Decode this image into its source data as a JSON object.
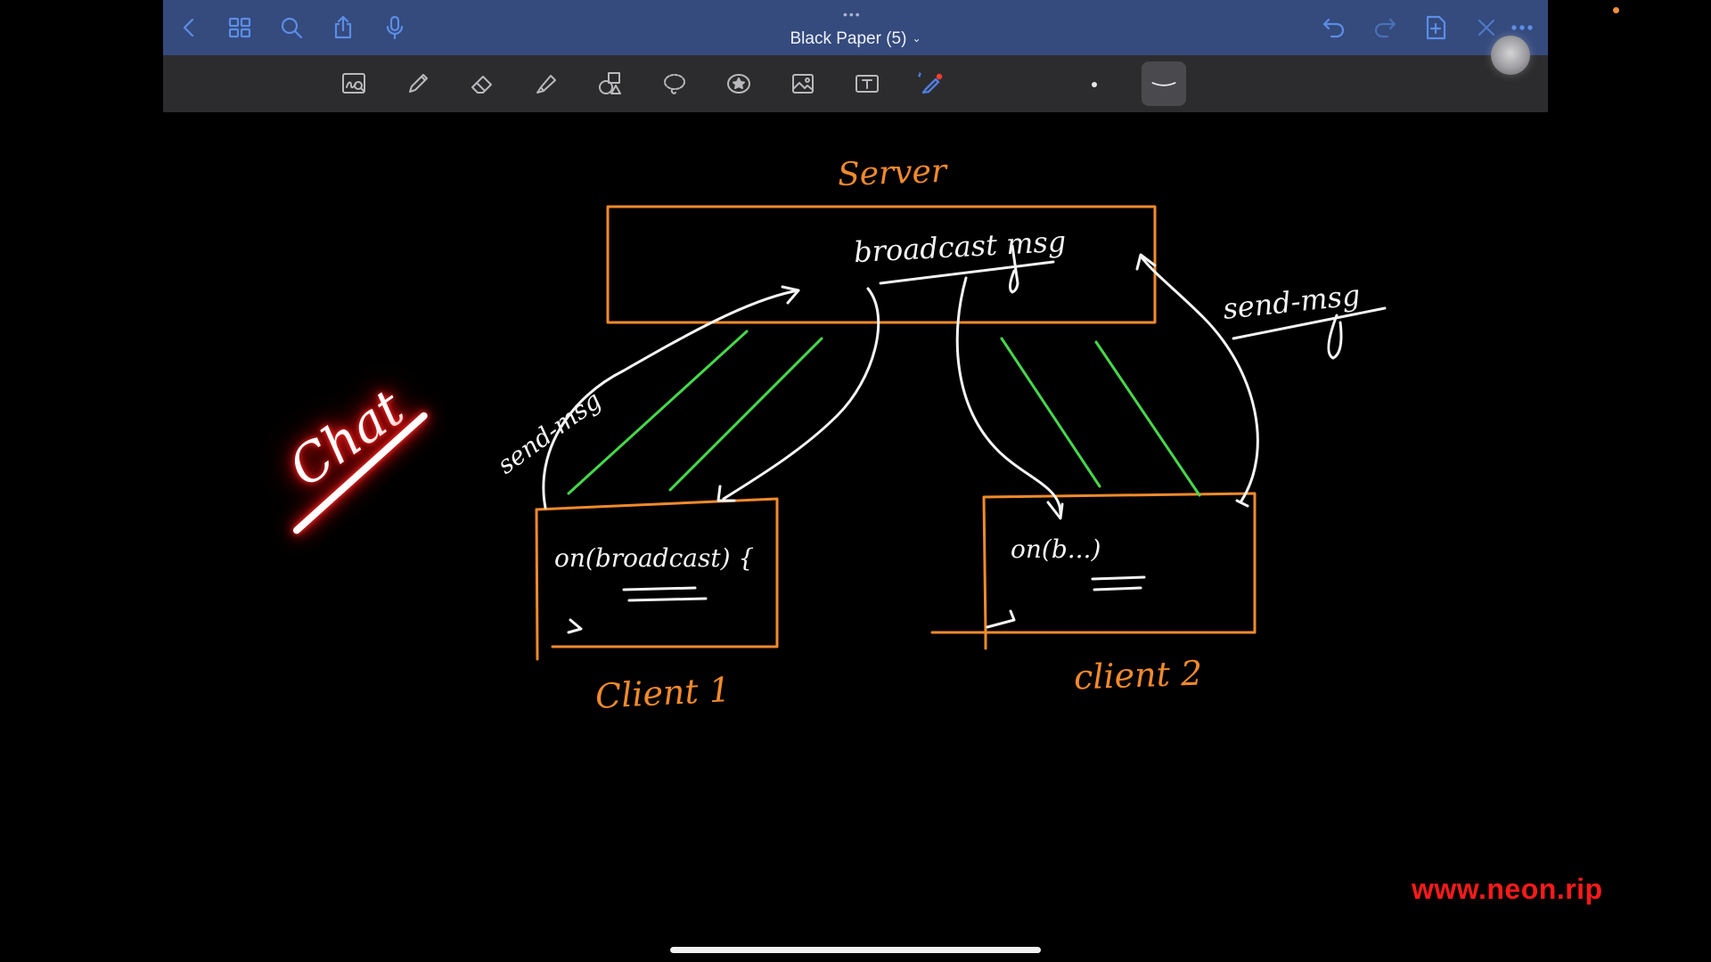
{
  "window": {
    "title": "Black Paper (5)",
    "title_chevron": "⌄",
    "grabber": "•••"
  },
  "titlebar_icons": [
    "back-icon",
    "grid-icon",
    "search-icon",
    "share-icon",
    "microphone-icon",
    "undo-icon",
    "redo-icon",
    "add-page-icon",
    "close-icon",
    "more-icon"
  ],
  "tool_icons": [
    "zoom-window-icon",
    "pen-icon",
    "eraser-icon",
    "highlighter-icon",
    "shapes-icon",
    "lasso-icon",
    "sticker-icon",
    "image-icon",
    "text-box-icon",
    "laser-pointer-icon"
  ],
  "colors": {
    "titlebar": "#354a7d",
    "toolbar": "#2c2c2e",
    "icon_blue": "#5b8ee6",
    "ink_orange": "#f28a2c",
    "ink_white": "#f4f4f4",
    "ink_green": "#46d84a",
    "neon_red": "#ff1a1a"
  },
  "canvas": {
    "server_label": "Server",
    "broadcast_label": "broadcast msg",
    "send_left_label": "send-msg",
    "send_right_label": "send-msg",
    "client1_code": "on(broadcast) {",
    "client2_code": "on(b...)",
    "client1_label": "Client 1",
    "client2_label": "client 2",
    "chat_label": "Chat"
  },
  "watermark": "www.neon.rip"
}
